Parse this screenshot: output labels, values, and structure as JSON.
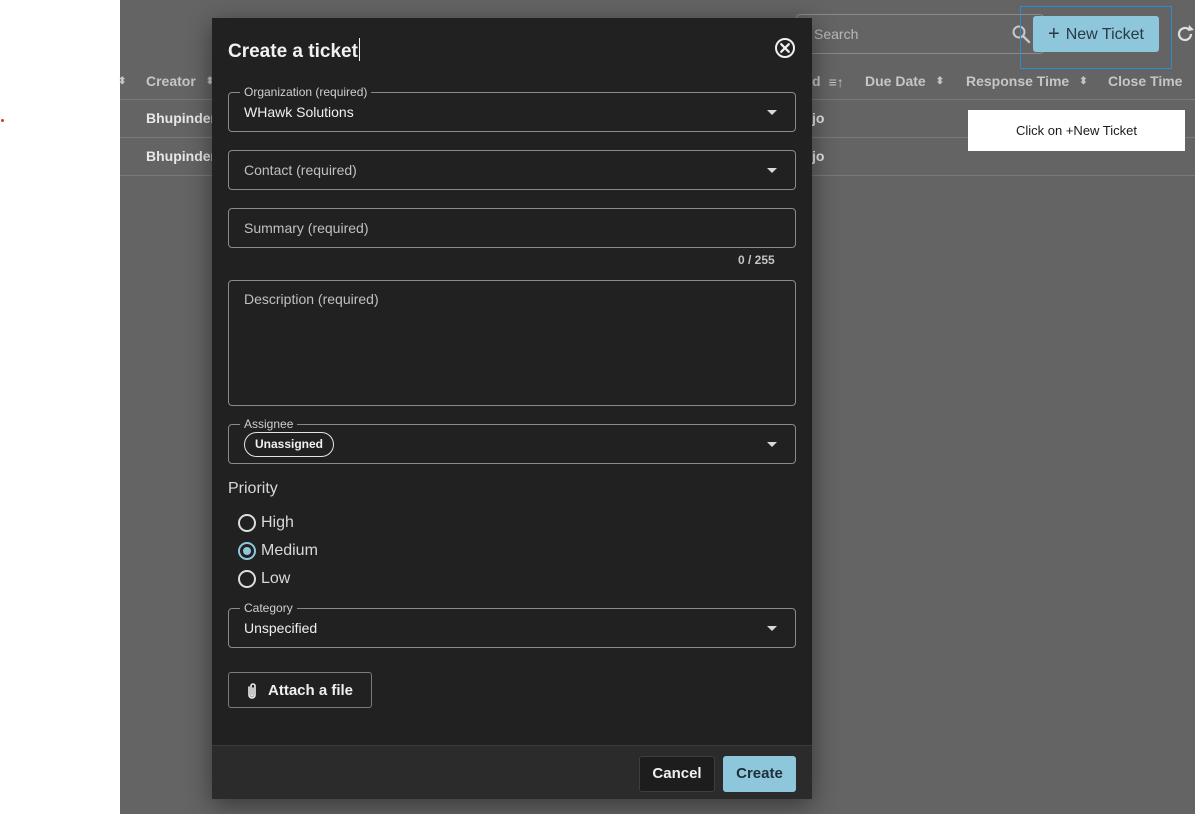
{
  "background_table": {
    "columns": [
      {
        "label": "",
        "sortable": true
      },
      {
        "label": "Creator",
        "sortable": true
      },
      {
        "label": "d",
        "sortable": true
      },
      {
        "label": "Due Date",
        "sortable": true
      },
      {
        "label": "Response Time",
        "sortable": true
      },
      {
        "label": "Close Time",
        "sortable": true
      }
    ],
    "rows": [
      {
        "creator": "Bhupinder",
        "created_fragment": "jo"
      },
      {
        "creator": "Bhupinder",
        "created_fragment": "jo"
      }
    ]
  },
  "toolbar": {
    "search_placeholder": "Search",
    "new_ticket_label": "New Ticket"
  },
  "tooltip": {
    "text": "Click on +New Ticket"
  },
  "dialog": {
    "title": "Create a ticket",
    "organization": {
      "label": "Organization (required)",
      "value": "WHawk Solutions"
    },
    "contact": {
      "placeholder": "Contact (required)"
    },
    "summary": {
      "placeholder": "Summary (required)",
      "counter": "0 / 255"
    },
    "description": {
      "placeholder": "Description (required)"
    },
    "assignee": {
      "label": "Assignee",
      "chip": "Unassigned"
    },
    "priority": {
      "label": "Priority",
      "options": [
        "High",
        "Medium",
        "Low"
      ],
      "selected": "Medium"
    },
    "category": {
      "label": "Category",
      "value": "Unspecified"
    },
    "attach_label": "Attach a file",
    "cancel_label": "Cancel",
    "create_label": "Create"
  },
  "colors": {
    "accent": "#8ec6dc",
    "dialog_bg": "#212121",
    "overlay": "#646464",
    "highlight_border": "#2e8cc8"
  }
}
